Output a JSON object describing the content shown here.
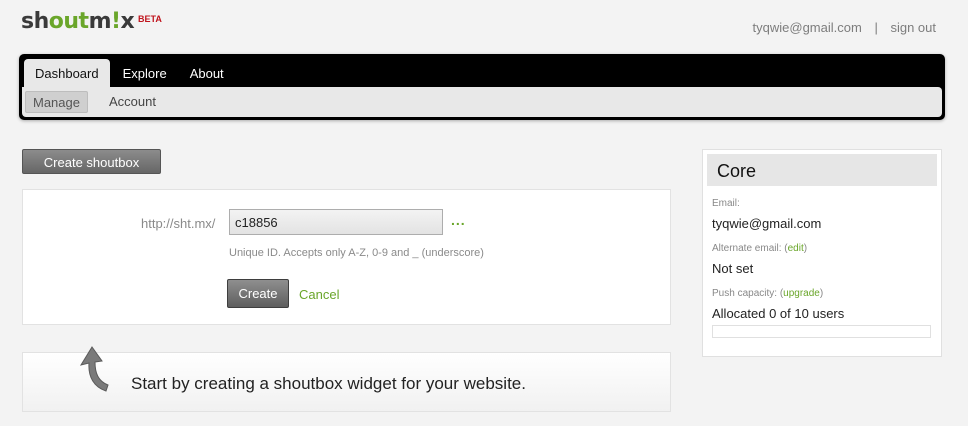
{
  "logo": {
    "part1": "sh",
    "part2": "out",
    "part3": "m",
    "part4": "!",
    "part5": "x",
    "badge": "BETA"
  },
  "user": {
    "email": "tyqwie@gmail.com",
    "separator": "|",
    "signout": "sign out"
  },
  "nav": {
    "tabs": [
      "Dashboard",
      "Explore",
      "About"
    ],
    "subtabs": [
      "Manage",
      "Account"
    ]
  },
  "create_shoutbox_label": "Create shoutbox",
  "form": {
    "url_prefix": "http://sht.mx/",
    "id_value": "c18856",
    "dots": "...",
    "hint": "Unique ID. Accepts only A-Z, 0-9 and _ (underscore)",
    "create_label": "Create",
    "cancel_label": "Cancel"
  },
  "info": {
    "text": "Start by creating a shoutbox widget for your website."
  },
  "sidebar": {
    "title": "Core",
    "email_label": "Email:",
    "email_value": "tyqwie@gmail.com",
    "alt_email_label": "Alternate email:",
    "alt_email_link": "edit",
    "alt_email_value": "Not set",
    "push_label": "Push capacity:",
    "push_link": "upgrade",
    "push_value": "Allocated 0 of 10 users",
    "push_fraction": 0
  },
  "colors": {
    "accent": "#6aa62a",
    "beta": "#c0141d"
  },
  "icons": {
    "arrow": "curved-up-arrow-icon"
  }
}
